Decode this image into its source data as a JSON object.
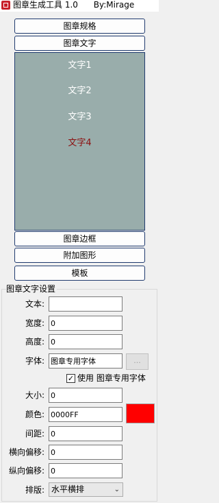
{
  "window": {
    "title": "图章生成工具 1.0      By:Mirage"
  },
  "nav": {
    "spec_label": "图章规格",
    "text_label": "图章文字",
    "border_label": "图章边框",
    "shape_label": "附加图形",
    "template_label": "模板"
  },
  "text_list": {
    "items": [
      "文字1",
      "文字2",
      "文字3",
      "文字4"
    ],
    "selected": "文字4"
  },
  "settings": {
    "group_title": "图章文字设置",
    "text_label": "文本:",
    "text_value": "",
    "width_label": "宽度:",
    "width_value": "0",
    "height_label": "高度:",
    "height_value": "0",
    "font_label": "字体:",
    "font_value": "图章专用字体",
    "browse_label": "...",
    "use_font_checked": "✓",
    "use_font_label": "使用 图章专用字体",
    "size_label": "大小:",
    "size_value": "0",
    "color_label": "颜色:",
    "color_value": "0000FF",
    "swatch_color": "#ff0000",
    "spacing_label": "间距:",
    "spacing_value": "0",
    "hoffset_label": "横向偏移:",
    "hoffset_value": "0",
    "voffset_label": "纵向偏移:",
    "voffset_value": "0",
    "layout_label": "排版:",
    "layout_value": "水平横排"
  },
  "colors": {
    "panel_bg": "#99adab",
    "selected_text": "#8b1010",
    "accent_border": "#1f3a6e"
  }
}
